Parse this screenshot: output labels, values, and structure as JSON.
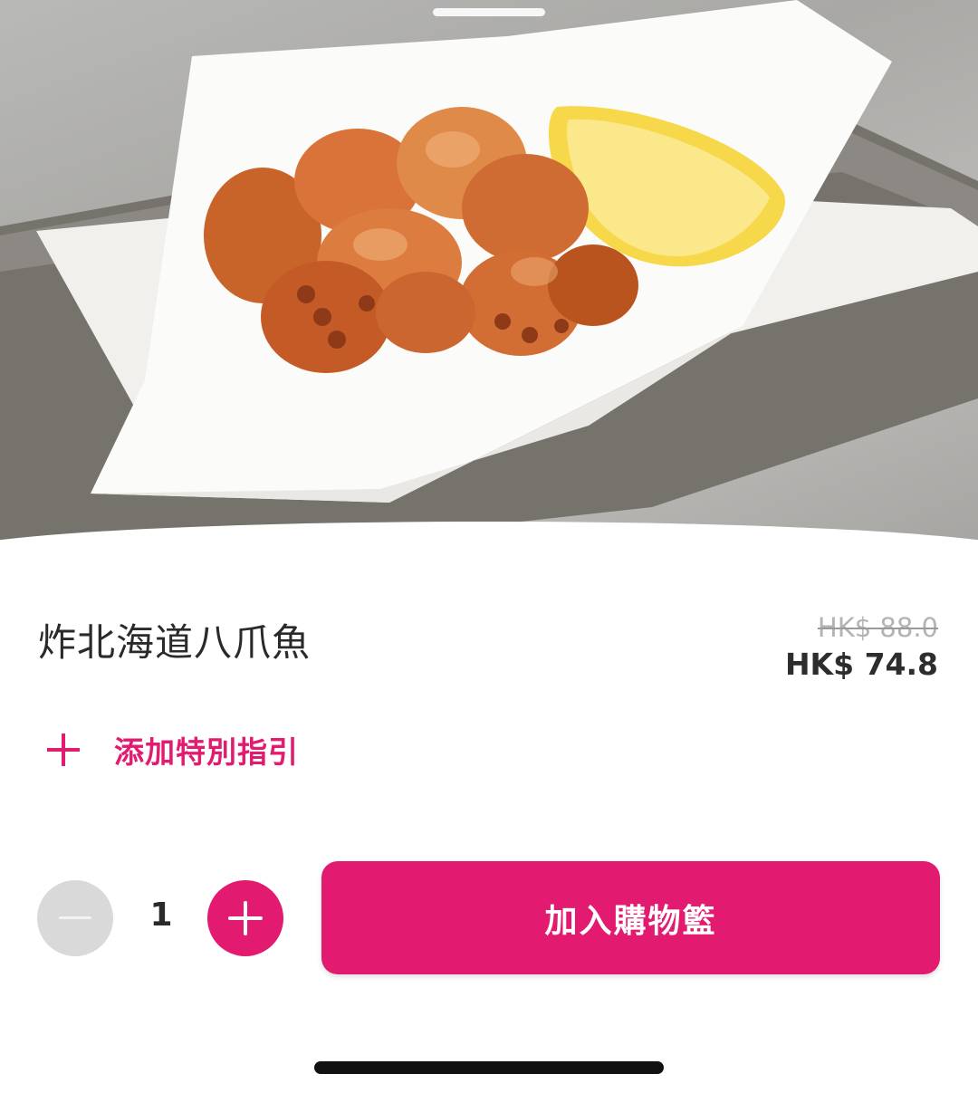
{
  "product": {
    "name": "炸北海道八爪魚",
    "original_price": "HK$ 88.0",
    "current_price": "HK$ 74.8",
    "image_alt": "fried octopus photo"
  },
  "special_instructions": {
    "label": "添加特別指引",
    "icon": "plus-icon"
  },
  "quantity": {
    "value": "1",
    "decrement_icon": "minus-icon",
    "increment_icon": "plus-icon"
  },
  "cart": {
    "add_label": "加入購物籃"
  },
  "colors": {
    "accent": "#e21b70",
    "minus_button": "#d9d9d9",
    "text": "#2a2a2a",
    "strikethrough_price": "#b3b3b3"
  }
}
